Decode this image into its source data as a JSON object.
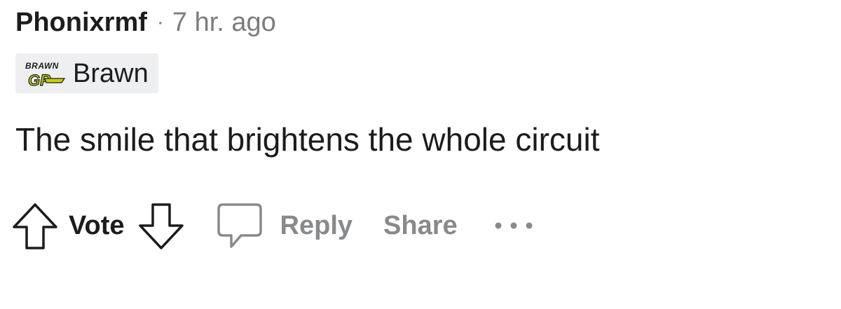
{
  "comment": {
    "author": "Phonixrmf",
    "separator": "·",
    "time_ago": "7 hr. ago",
    "flair": {
      "logo_top": "BRAWN",
      "logo_bottom": "GP",
      "text": "Brawn"
    },
    "body": "The smile that brightens the whole circuit"
  },
  "actions": {
    "vote_label": "Vote",
    "reply_label": "Reply",
    "share_label": "Share",
    "more_label": "•••"
  },
  "colors": {
    "text": "#1c1c1c",
    "muted": "#878a8c",
    "flair_bg": "#edeff1",
    "brawn_gp_yellow": "#c9d000"
  },
  "icons": [
    "upvote-icon",
    "downvote-icon",
    "comment-icon",
    "more-icon",
    "brawn-gp-logo"
  ]
}
